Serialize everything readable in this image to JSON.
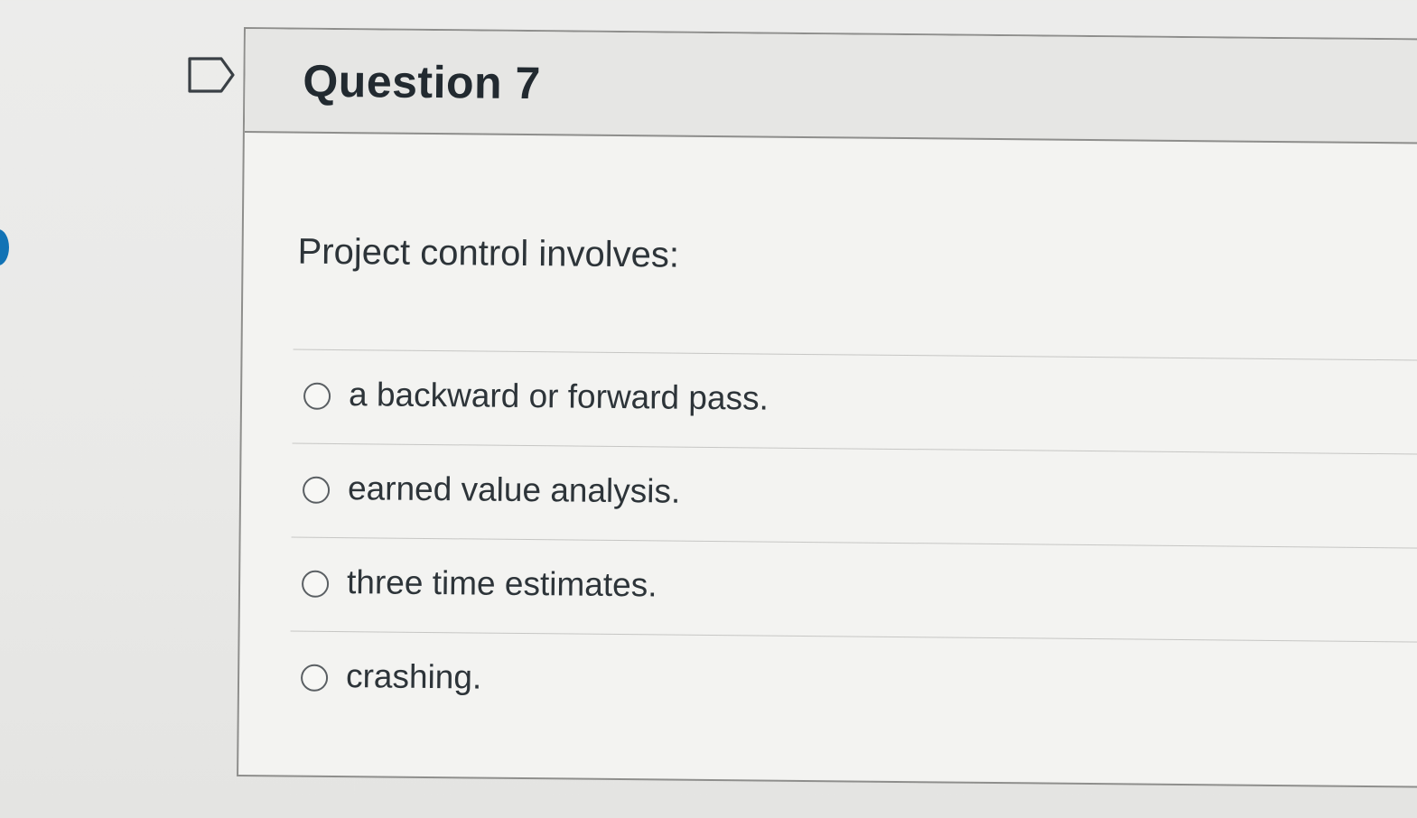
{
  "question": {
    "title": "Question 7",
    "text": "Project control involves:",
    "answers": [
      {
        "label": "a backward or forward pass."
      },
      {
        "label": "earned value analysis."
      },
      {
        "label": "three time estimates."
      },
      {
        "label": "crashing."
      }
    ]
  },
  "icons": {
    "flag": "flag-question-icon",
    "radio": "radio-button-icon"
  },
  "colors": {
    "accent": "#1273b5",
    "header_bg": "#e6e6e4",
    "border": "#8e8e8c"
  }
}
